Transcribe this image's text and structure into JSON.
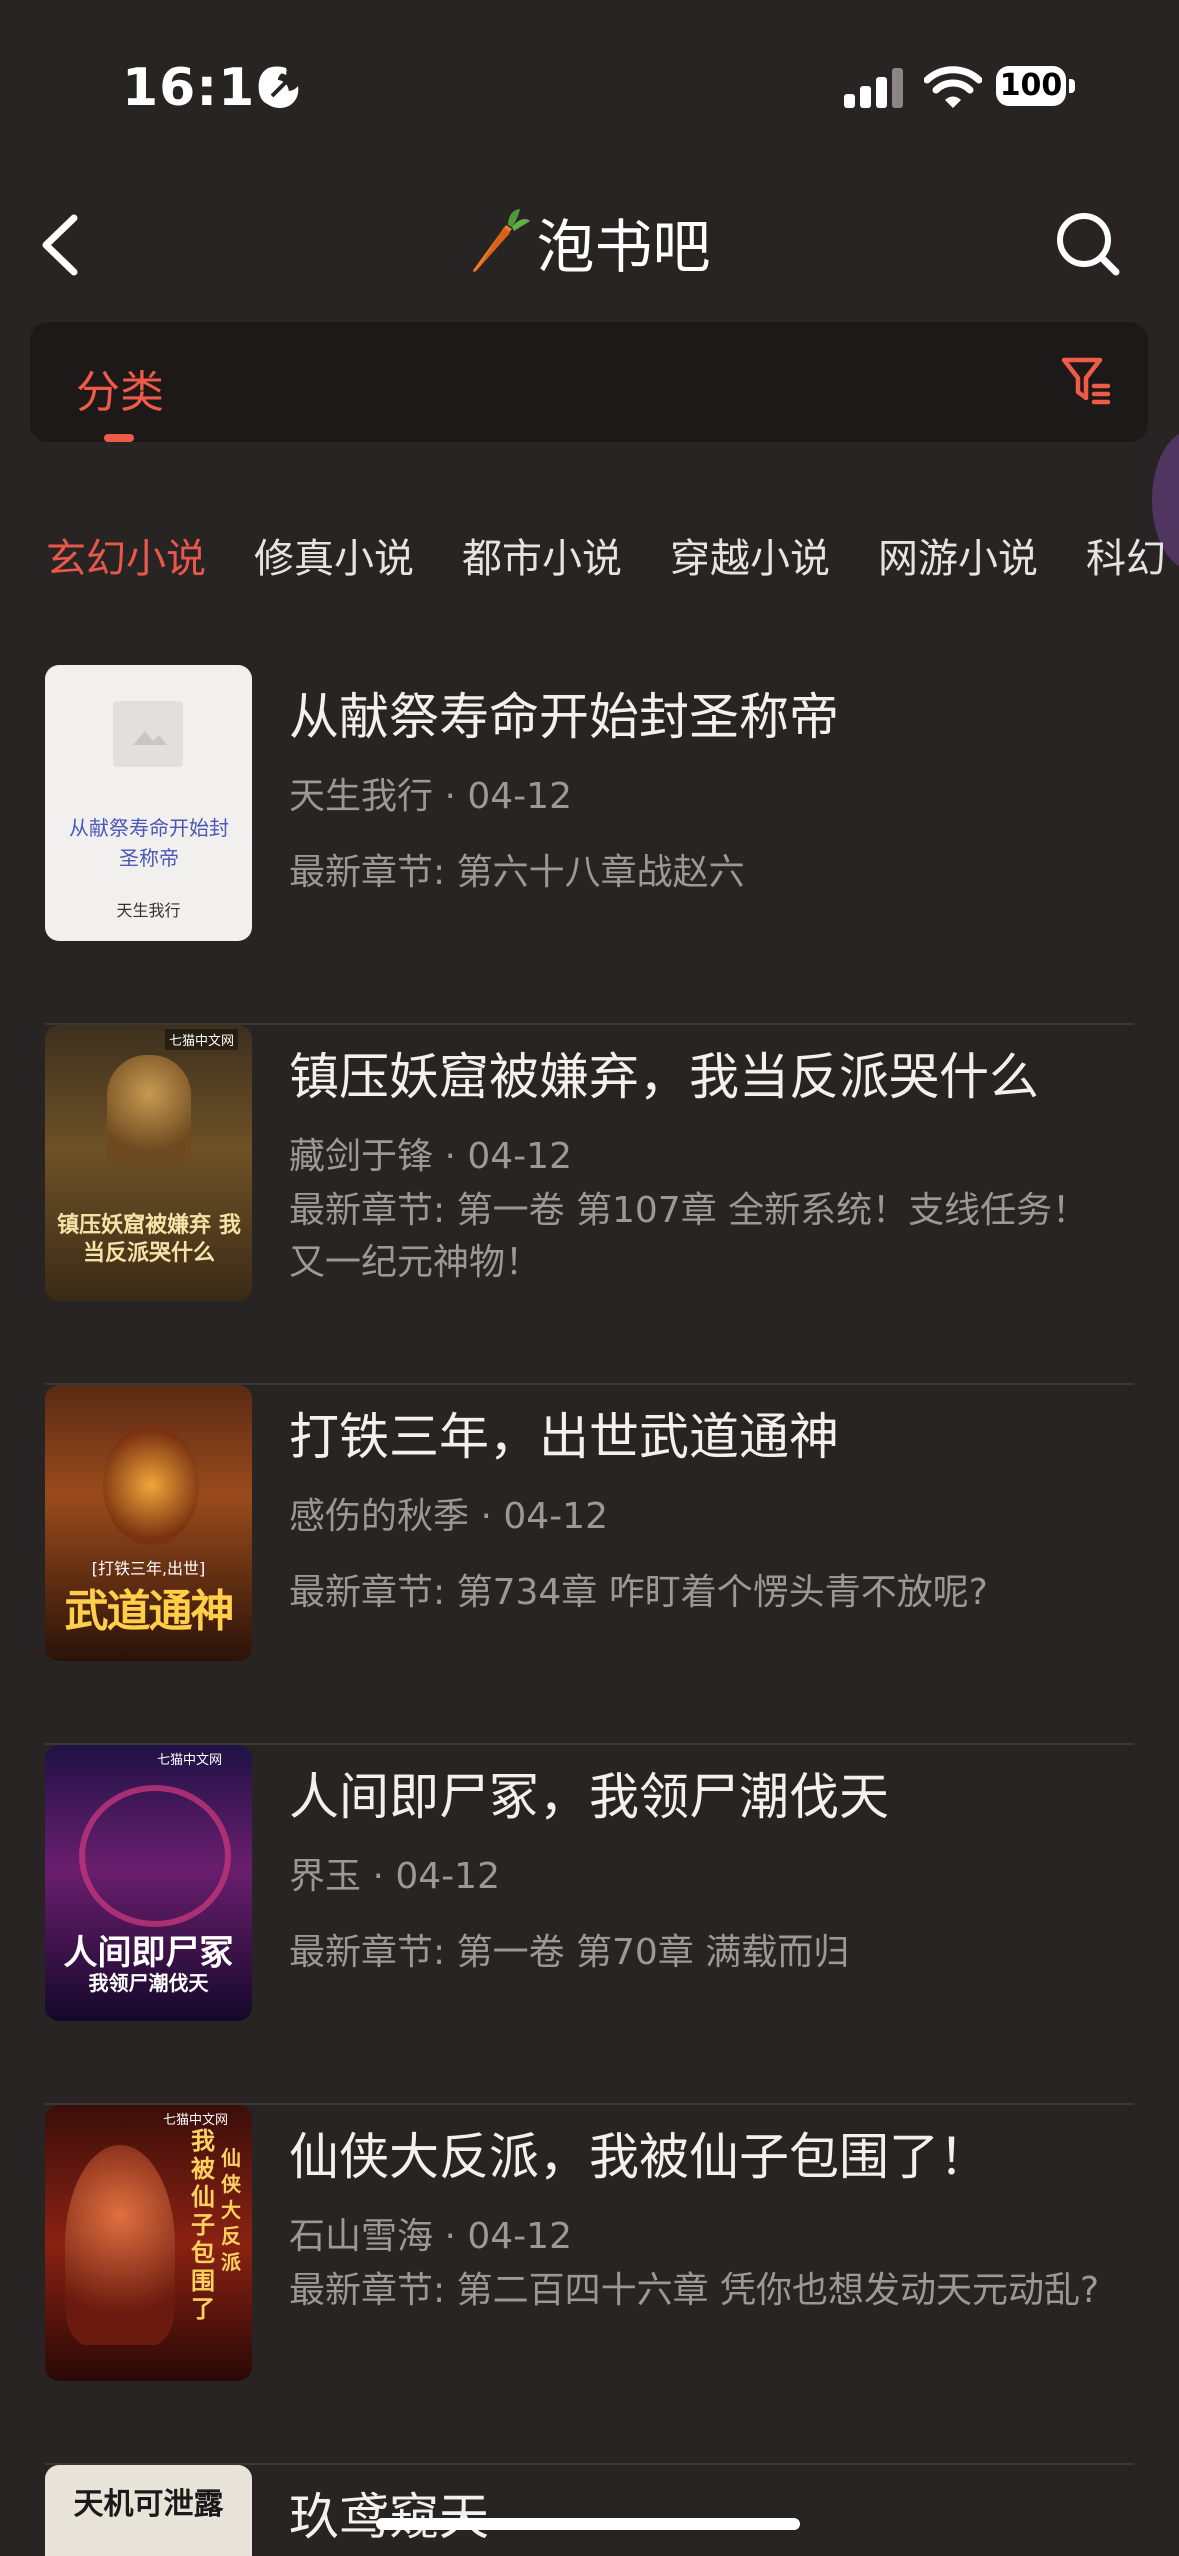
{
  "status": {
    "time": "16:16",
    "battery": "100"
  },
  "header": {
    "title": "泡书吧"
  },
  "category": {
    "label": "分类"
  },
  "genres": [
    "玄幻小说",
    "修真小说",
    "都市小说",
    "穿越小说",
    "网游小说",
    "科幻"
  ],
  "books": [
    {
      "title": "从献祭寿命开始封圣称帝",
      "author": "天生我行",
      "date": "04-12",
      "latest": "最新章节: 第六十八章战赵六",
      "cover_title": "从献祭寿命开始封圣称帝",
      "cover_author": "天生我行"
    },
    {
      "title": "镇压妖窟被嫌弃，我当反派哭什么",
      "author": "藏剑于锋",
      "date": "04-12",
      "latest": "最新章节: 第一卷 第107章 全新系统！支线任务！又一纪元神物！",
      "cover_title": "镇压妖窟被嫌弃 我当反派哭什么",
      "cover_badge": "七猫中文网"
    },
    {
      "title": "打铁三年，出世武道通神",
      "author": "感伤的秋季",
      "date": "04-12",
      "latest": "最新章节: 第734章 咋盯着个愣头青不放呢?",
      "cover_top": "[打铁三年,出世]",
      "cover_main": "武道通神"
    },
    {
      "title": "人间即尸冢，我领尸潮伐天",
      "author": "界玉",
      "date": "04-12",
      "latest": "最新章节: 第一卷 第70章 满载而归",
      "cover_main": "人间即尸冢",
      "cover_sub": "我领尸潮伐天",
      "cover_badge": "七猫中文网"
    },
    {
      "title": "仙侠大反派，我被仙子包围了！",
      "author": "石山雪海",
      "date": "04-12",
      "latest": "最新章节: 第二百四十六章 凭你也想发动天元动乱?",
      "cover_col1": "我被仙子包围了",
      "cover_col2": "仙侠大反派",
      "cover_badge": "七猫中文网"
    },
    {
      "title": "玖鸢窥天",
      "cover_title": "天机可泄露"
    }
  ],
  "colors": {
    "accent": "#ee5b48",
    "background": "#272423"
  },
  "icons": [
    "back-arrow-icon",
    "carrot-icon",
    "search-icon",
    "filter-icon",
    "moon-icon",
    "signal-icon",
    "wifi-icon",
    "battery-icon"
  ]
}
